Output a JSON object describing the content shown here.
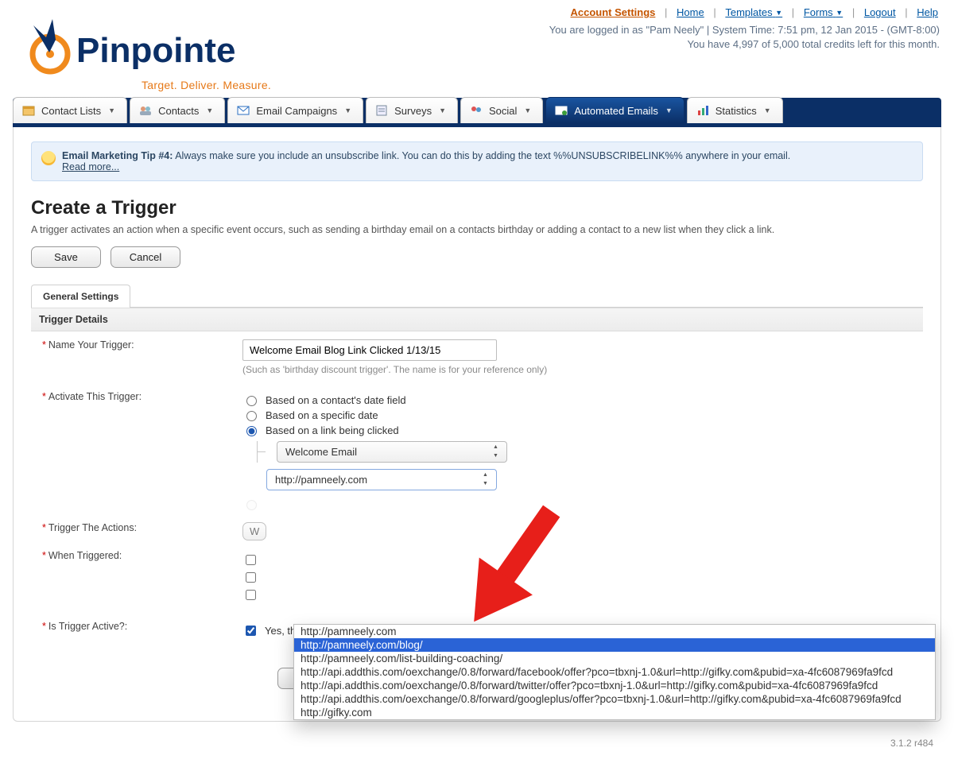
{
  "header": {
    "top_links": {
      "account": "Account Settings",
      "home": "Home",
      "templates": "Templates",
      "forms": "Forms",
      "logout": "Logout",
      "help": "Help"
    },
    "status_line1": "You are logged in as \"Pam Neely\" | System Time: 7:51 pm, 12 Jan 2015 - (GMT-8:00)",
    "status_line2": "You have 4,997 of 5,000 total credits left for this month.",
    "brand": "Pinpointe",
    "tagline": "Target. Deliver. Measure."
  },
  "nav": {
    "items": [
      {
        "label": "Contact Lists"
      },
      {
        "label": "Contacts"
      },
      {
        "label": "Email Campaigns"
      },
      {
        "label": "Surveys"
      },
      {
        "label": "Social"
      },
      {
        "label": "Automated Emails",
        "active": true
      },
      {
        "label": "Statistics"
      }
    ]
  },
  "tip": {
    "title": "Email Marketing Tip #4:",
    "body": "Always make sure you include an unsubscribe link. You can do this by adding the text %%UNSUBSCRIBELINK%% anywhere in your email.",
    "more": "Read more..."
  },
  "page": {
    "title": "Create a Trigger",
    "desc": "A trigger activates an action when a specific event occurs, such as sending a birthday email on a contacts birthday or adding a contact to a new list when they click a link.",
    "save": "Save",
    "cancel": "Cancel",
    "tab": "General Settings",
    "section": "Trigger Details"
  },
  "form": {
    "name_label": "Name Your Trigger:",
    "name_value": "Welcome Email Blog Link Clicked 1/13/15",
    "name_hint": "(Such as 'birthday discount trigger'. The name is for your reference only)",
    "activate_label": "Activate This Trigger:",
    "activate_opts": {
      "date_field": "Based on a contact's date field",
      "specific_date": "Based on a specific date",
      "link_clicked": "Based on a link being clicked"
    },
    "campaign_select": "Welcome Email",
    "link_select": "http://pamneely.com",
    "dropdown_options": [
      "http://pamneely.com",
      "http://pamneely.com/blog/",
      "http://pamneely.com/list-building-coaching/",
      "http://api.addthis.com/oexchange/0.8/forward/facebook/offer?pco=tbxnj-1.0&url=http://gifky.com&pubid=xa-4fc6087969fa9fcd",
      "http://api.addthis.com/oexchange/0.8/forward/twitter/offer?pco=tbxnj-1.0&url=http://gifky.com&pubid=xa-4fc6087969fa9fcd",
      "http://api.addthis.com/oexchange/0.8/forward/googleplus/offer?pco=tbxnj-1.0&url=http://gifky.com&pubid=xa-4fc6087969fa9fcd",
      "http://gifky.com"
    ],
    "trigger_actions_label": "Trigger The Actions:",
    "when_triggered_label": "When Triggered:",
    "is_active_label": "Is Trigger Active?:",
    "is_active_text": "Yes, this trigger is active"
  },
  "footer": {
    "version": "3.1.2 r484"
  }
}
